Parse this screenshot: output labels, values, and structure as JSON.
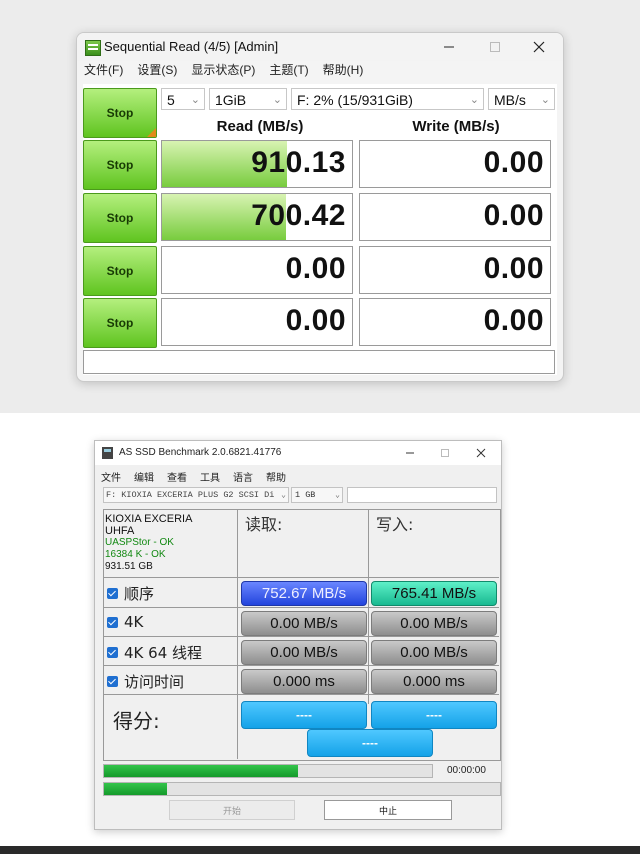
{
  "cdm": {
    "title": "Sequential Read (4/5) [Admin]",
    "menu": [
      "文件(F)",
      "设置(S)",
      "显示状态(P)",
      "主题(T)",
      "帮助(H)"
    ],
    "controls": {
      "count": "5",
      "size": "1GiB",
      "drive": "F: 2% (15/931GiB)",
      "unit": "MB/s"
    },
    "headers": {
      "read": "Read (MB/s)",
      "write": "Write (MB/s)"
    },
    "all_button": "Stop",
    "rows": [
      {
        "button": "Stop",
        "read": "910.13",
        "write": "0.00",
        "read_fill_pct": 66
      },
      {
        "button": "Stop",
        "read": "700.42",
        "write": "0.00",
        "read_fill_pct": 65
      },
      {
        "button": "Stop",
        "read": "0.00",
        "write": "0.00",
        "read_fill_pct": 0
      },
      {
        "button": "Stop",
        "read": "0.00",
        "write": "0.00",
        "read_fill_pct": 0
      }
    ],
    "status": ""
  },
  "asssd": {
    "title": "AS SSD Benchmark 2.0.6821.41776",
    "menu": [
      "文件",
      "编辑",
      "查看",
      "工具",
      "语言",
      "帮助"
    ],
    "drive": "F: KIOXIA EXCERIA PLUS G2 SCSI Di",
    "size": "1 GB",
    "info": {
      "name": "KIOXIA EXCERIA",
      "model": "UHFA",
      "driver": "UASPStor - OK",
      "align": "16384 K - OK",
      "capacity": "931.51 GB"
    },
    "col_read": "读取:",
    "col_write": "写入:",
    "rows": [
      {
        "label": "顺序",
        "read": "752.67 MB/s",
        "write": "765.41 MB/s"
      },
      {
        "label": "4K",
        "read": "0.00 MB/s",
        "write": "0.00 MB/s"
      },
      {
        "label": "4K 64 线程",
        "read": "0.00 MB/s",
        "write": "0.00 MB/s"
      },
      {
        "label": "访问时间",
        "read": "0.000 ms",
        "write": "0.000 ms"
      }
    ],
    "score_label": "得分:",
    "scores": {
      "read": "----",
      "write": "----",
      "total": "----"
    },
    "progress_pct": 59,
    "progress2_pct": 16,
    "time": "00:00:00",
    "start": "开始",
    "abort": "中止",
    "colors": {
      "seq_read": "#2a4ae0",
      "seq_write": "#1fcf9f",
      "score": "#1aa8ee",
      "progress": "#1fa23a"
    }
  }
}
